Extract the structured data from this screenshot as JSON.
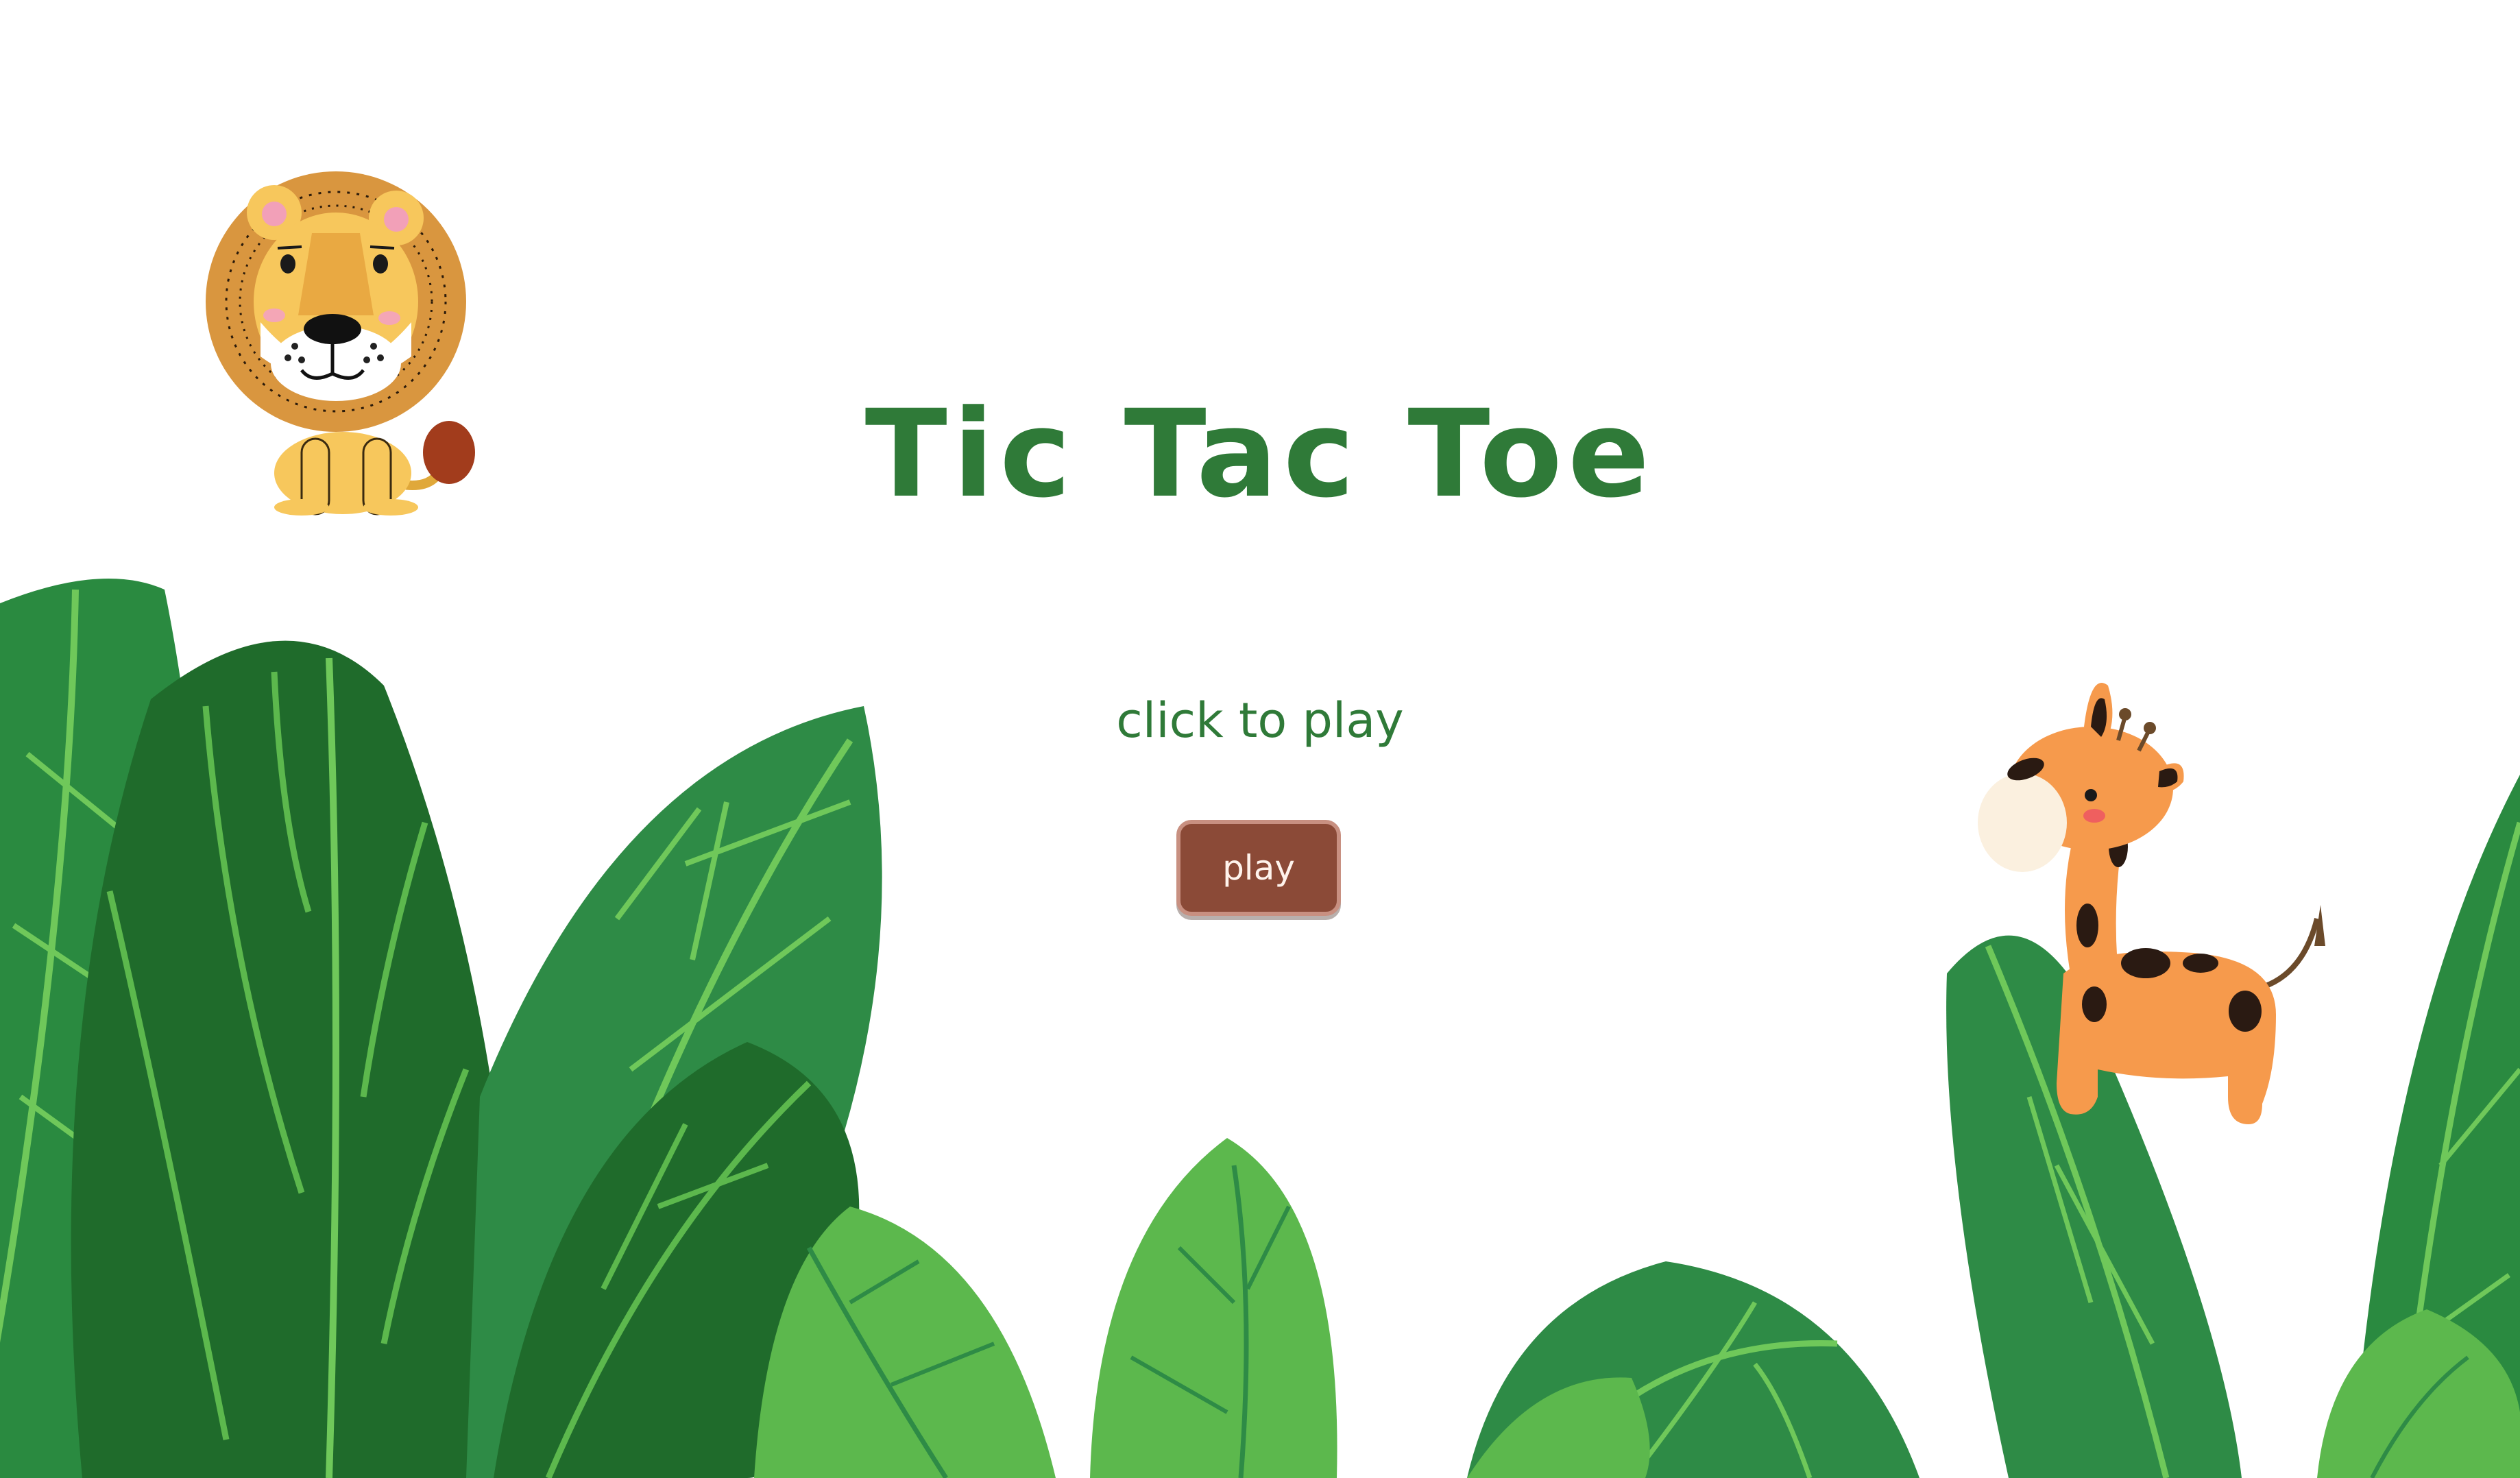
{
  "title": "Tic Tac Toe",
  "subtitle": "click to play",
  "play_button": {
    "label": "play"
  },
  "colors": {
    "title": "#2f7a38",
    "button_bg": "#8b4a37",
    "button_border": "#c89081",
    "leaf_dark": "#1f6b2b",
    "leaf_mid": "#2e8b46",
    "leaf_light": "#5cb84d",
    "vein": "#6fc85a"
  },
  "illustrations": [
    "lion",
    "giraffe",
    "jungle-leaves"
  ]
}
